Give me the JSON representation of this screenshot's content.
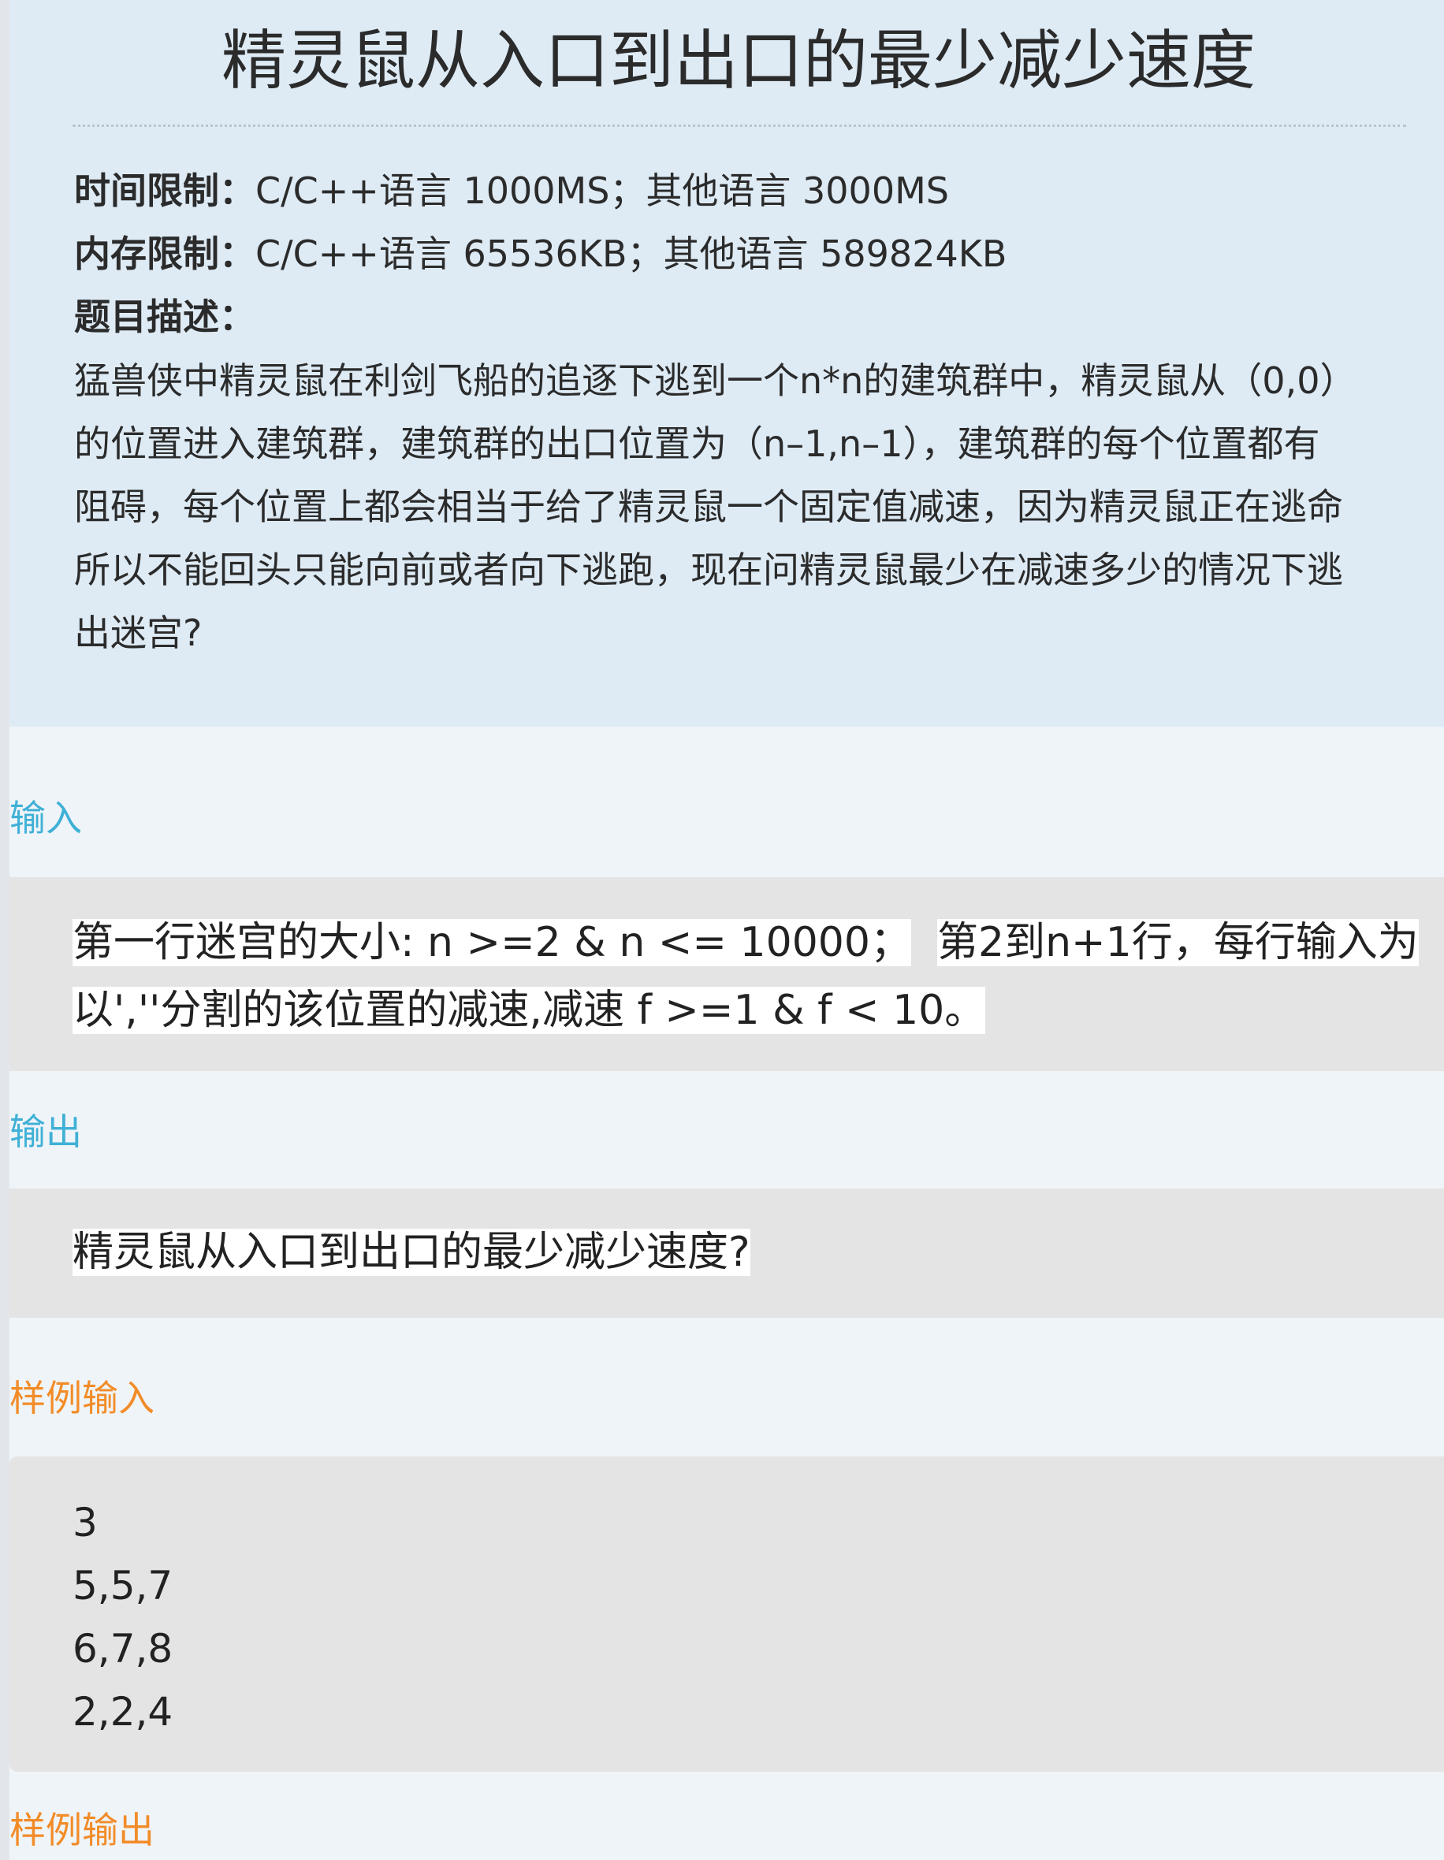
{
  "problem": {
    "title": "精灵鼠从入口到出口的最少减少速度",
    "time_limit_label": "时间限制：",
    "time_limit_value": "C/C++语言 1000MS；其他语言 3000MS",
    "memory_limit_label": "内存限制：",
    "memory_limit_value": "C/C++语言 65536KB；其他语言 589824KB",
    "description_label": "题目描述：",
    "description_lines": [
      "猛兽侠中精灵鼠在利剑飞船的追逐下逃到一个n*n的建筑群中，精灵鼠从（0,0）",
      "的位置进入建筑群，建筑群的出口位置为（n–1,n–1），建筑群的每个位置都有",
      "阻碍，每个位置上都会相当于给了精灵鼠一个固定值减速，因为精灵鼠正在逃命",
      "所以不能回头只能向前或者向下逃跑，现在问精灵鼠最少在减速多少的情况下逃",
      "出迷宫?"
    ]
  },
  "input_section": {
    "label": "输入",
    "line1a": "第一行迷宫的大小: n >=2 & n <= 10000；",
    "line1b": "第2到n+1行，每行输入为",
    "line2": "以',''分割的该位置的减速,减速 f >=1 & f < 10。"
  },
  "output_section": {
    "label": "输出",
    "text": "精灵鼠从入口到出口的最少减少速度?"
  },
  "sample_input": {
    "label": "样例输入",
    "lines": [
      "3",
      "5,5,7",
      "6,7,8",
      "2,2,4"
    ]
  },
  "sample_output": {
    "label": "样例输出"
  }
}
